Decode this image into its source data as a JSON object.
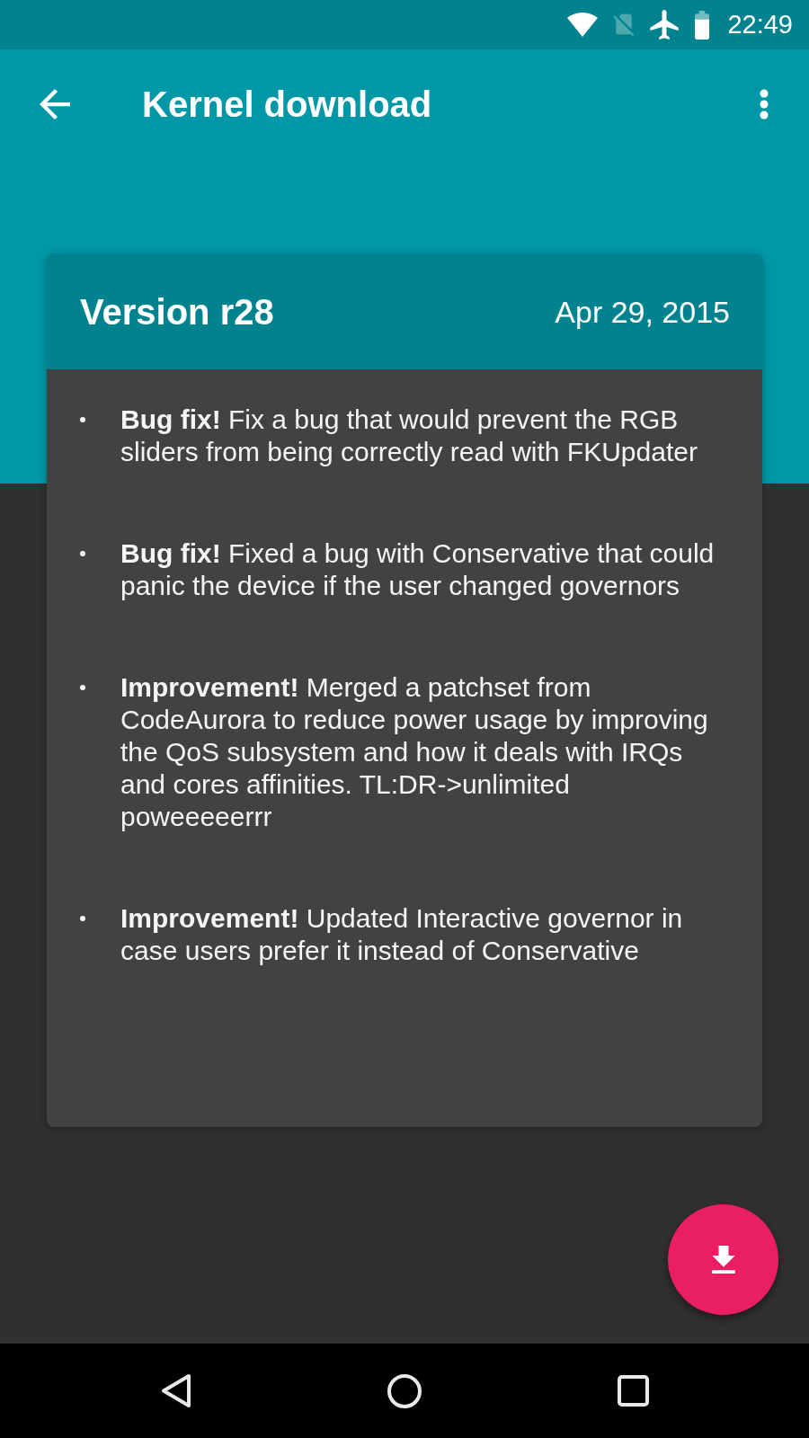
{
  "status_bar": {
    "time": "22:49"
  },
  "app_bar": {
    "title": "Kernel download"
  },
  "card": {
    "title": "Version r28",
    "date": "Apr 29, 2015",
    "items": [
      "**Bug fix!** Fix a bug that would prevent the RGB sliders from being correctly read with FKUpdater",
      "**Bug fix!** Fixed a bug with Conservative that could panic the device if the user changed governors",
      "**Improvement!** Merged a patchset from CodeAurora to reduce power usage by improving the QoS subsystem and how it deals with IRQs and cores affinities. TL:DR->unlimited poweeeeerrr",
      "**Improvement!** Updated Interactive governor in case users prefer it instead of Conservative"
    ]
  }
}
